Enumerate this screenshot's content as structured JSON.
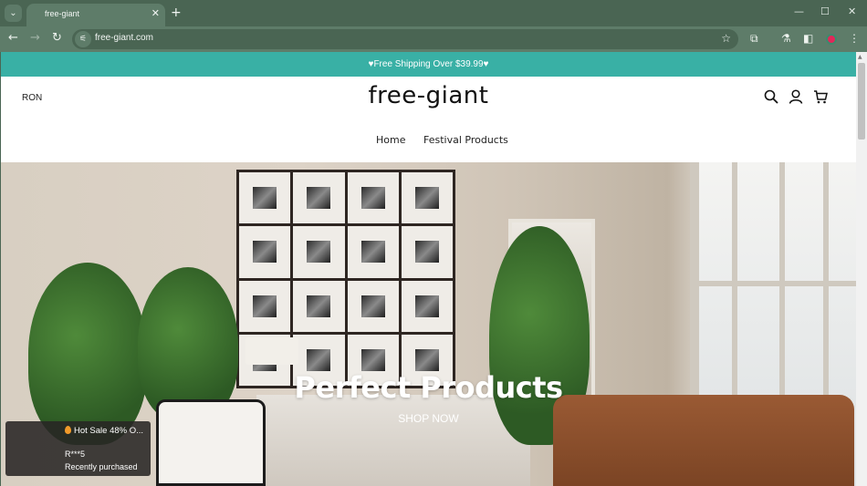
{
  "browser": {
    "tab_title": "free-giant",
    "url": "free-giant.com",
    "icons": {
      "tab_search": "chevron-down-icon",
      "close_tab": "close-icon",
      "new_tab": "plus-icon",
      "back": "arrow-left-icon",
      "forward": "arrow-right-icon",
      "reload": "reload-icon",
      "site_info": "tune-icon",
      "bookmark": "star-icon",
      "extensions": "puzzle-icon",
      "labs": "flask-icon",
      "side_panel": "side-panel-icon",
      "profile": "profile-avatar",
      "menu": "kebab-menu-icon",
      "minimize": "minimize-icon",
      "maximize": "maximize-icon",
      "close_window": "close-icon"
    },
    "glyphs": {
      "tab_search": "⌄",
      "close_tab": "✕",
      "new_tab": "+",
      "back": "←",
      "forward": "→",
      "reload": "↻",
      "site_info": "⚟",
      "bookmark": "☆",
      "extensions": "⧉",
      "labs": "⚗",
      "side_panel": "◧",
      "menu": "⋮",
      "minimize": "—",
      "maximize": "☐",
      "close_window": "✕"
    }
  },
  "site": {
    "announcement": "♥Free Shipping Over $39.99♥",
    "language": "RON",
    "logo": "free-giant",
    "nav": [
      {
        "label": "Home"
      },
      {
        "label": "Festival Products"
      }
    ],
    "header_icons": [
      "search-icon",
      "account-icon",
      "cart-icon"
    ],
    "colors": {
      "announcement_bg": "#39b0a5",
      "browser_frame": "#4a6553"
    }
  },
  "hero": {
    "title": "Perfect Products",
    "cta": "SHOP NOW"
  },
  "toast": {
    "title": "Hot Sale 48% O...",
    "user": "R***5",
    "subtitle": "Recently purchased"
  }
}
